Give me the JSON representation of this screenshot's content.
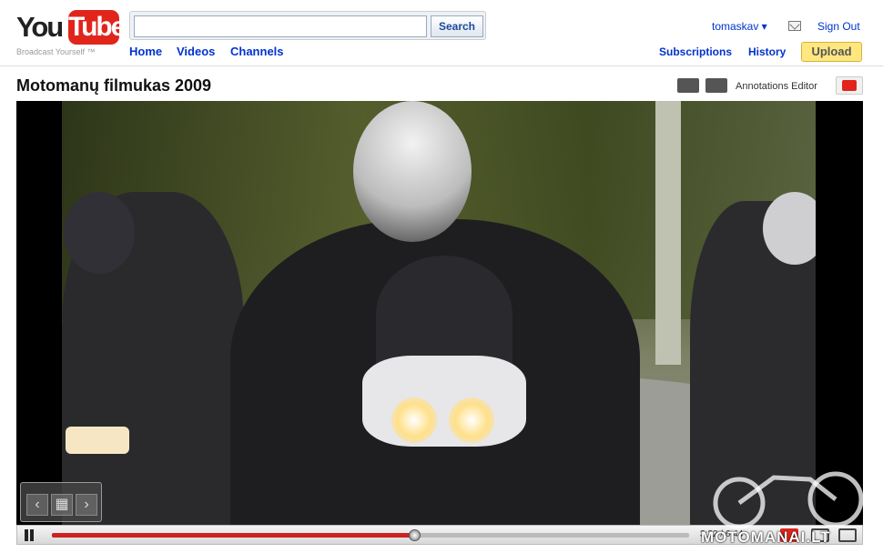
{
  "header": {
    "logo_you": "You",
    "logo_tube": "Tube",
    "tagline": "Broadcast Yourself ™",
    "search": {
      "placeholder": "",
      "value": "",
      "button_label": "Search"
    },
    "nav": [
      {
        "label": "Home"
      },
      {
        "label": "Videos"
      },
      {
        "label": "Channels"
      }
    ],
    "user": {
      "name": "tomaskav ▾",
      "sign_out": "Sign Out"
    },
    "secondary": {
      "subscriptions": "Subscriptions",
      "history": "History",
      "upload": "Upload"
    }
  },
  "video": {
    "title": "Motomanų filmukas 2009",
    "annotations_label": "Annotations Editor",
    "progress": 0.57,
    "time_readout": "3:22 / 6:44",
    "watermark": "MOTOMANAI.LT"
  },
  "colors": {
    "accent": "#e1251b",
    "link": "#0033cc",
    "upload": "#ffe780"
  },
  "icons": [
    "mail-icon",
    "pause-icon",
    "hq-icon",
    "fullscreen-icon",
    "popout-icon",
    "chevron-left-icon",
    "chevron-right-icon"
  ]
}
